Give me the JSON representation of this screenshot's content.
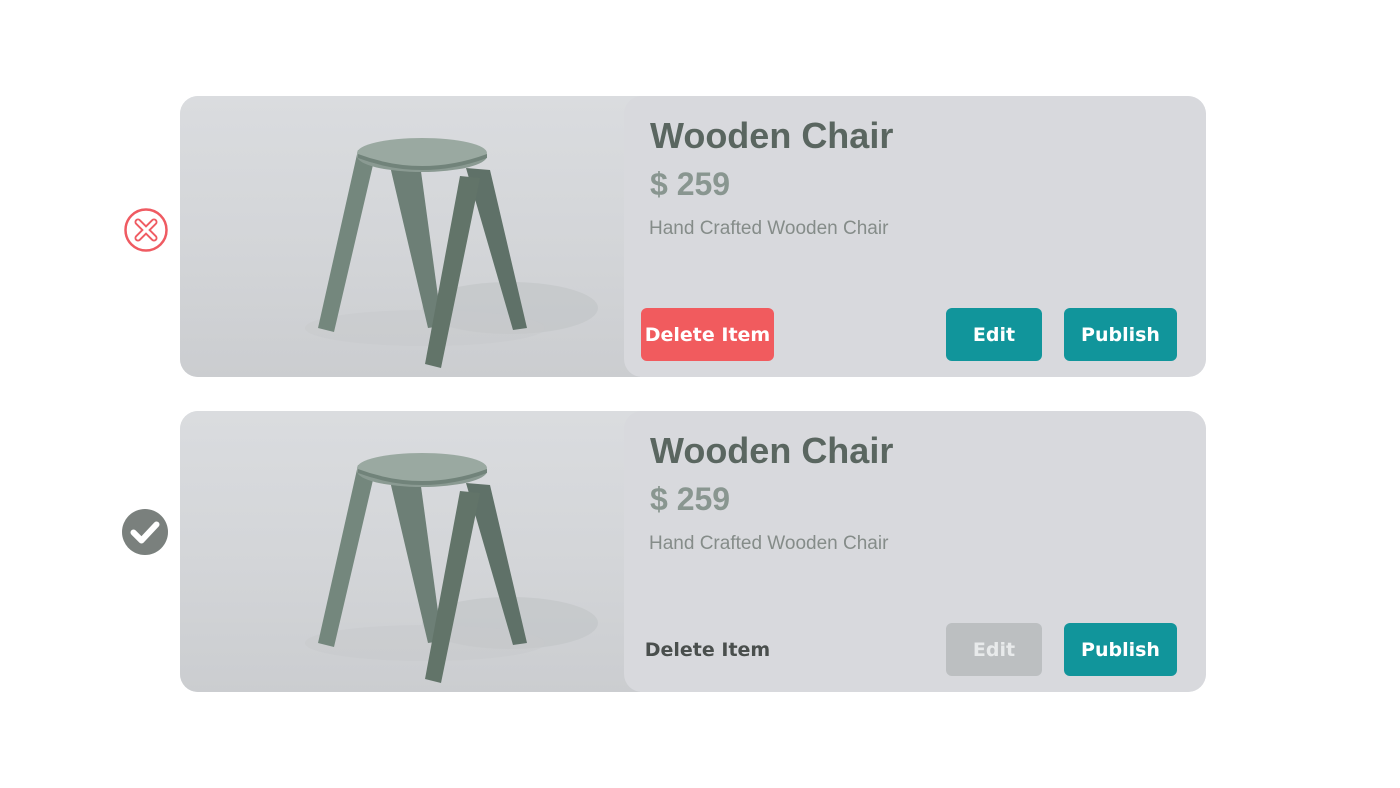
{
  "rows": [
    {
      "status": "incorrect",
      "status_icon": "x-circle-icon",
      "status_color": "#ef5b62",
      "title": "Wooden Chair",
      "price": "$ 259",
      "description": "Hand Crafted Wooden Chair",
      "delete_label": "Delete Item",
      "edit_label": "Edit",
      "publish_label": "Publish"
    },
    {
      "status": "correct",
      "status_icon": "check-circle-icon",
      "status_color": "#7a807d",
      "title": "Wooden Chair",
      "price": "$ 259",
      "description": "Hand Crafted Wooden Chair",
      "delete_label": "Delete Item",
      "edit_label": "Edit",
      "publish_label": "Publish"
    }
  ],
  "colors": {
    "accent_teal": "#11959b",
    "danger_red": "#f15b5e",
    "disabled_gray": "#bcbfc1",
    "card_background": "#d8dade"
  }
}
